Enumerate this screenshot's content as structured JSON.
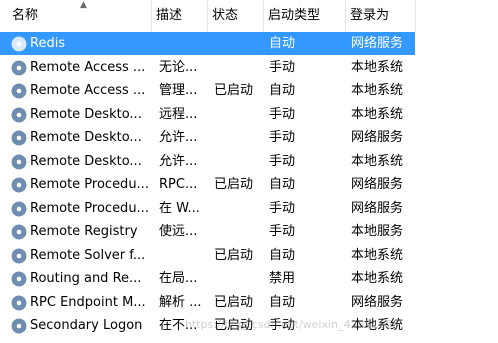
{
  "columns": {
    "name": "名称",
    "description": "描述",
    "status": "状态",
    "startup_type": "启动类型",
    "logon_as": "登录为"
  },
  "sort_indicator": "ascending",
  "rows": [
    {
      "name": "Redis",
      "description": "",
      "status": "",
      "startup_type": "自动",
      "logon_as": "网络服务",
      "selected": true
    },
    {
      "name": "Remote Access ...",
      "description": "无论...",
      "status": "",
      "startup_type": "手动",
      "logon_as": "本地系统"
    },
    {
      "name": "Remote Access ...",
      "description": "管理...",
      "status": "已启动",
      "startup_type": "自动",
      "logon_as": "本地系统"
    },
    {
      "name": "Remote Deskto...",
      "description": "远程...",
      "status": "",
      "startup_type": "手动",
      "logon_as": "本地系统"
    },
    {
      "name": "Remote Deskto...",
      "description": "允许...",
      "status": "",
      "startup_type": "手动",
      "logon_as": "网络服务"
    },
    {
      "name": "Remote Deskto...",
      "description": "允许...",
      "status": "",
      "startup_type": "手动",
      "logon_as": "本地系统"
    },
    {
      "name": "Remote Procedu...",
      "description": "RPC...",
      "status": "已启动",
      "startup_type": "自动",
      "logon_as": "网络服务"
    },
    {
      "name": "Remote Procedu...",
      "description": "在 W...",
      "status": "",
      "startup_type": "手动",
      "logon_as": "网络服务"
    },
    {
      "name": "Remote Registry",
      "description": "使远...",
      "status": "",
      "startup_type": "手动",
      "logon_as": "本地服务"
    },
    {
      "name": "Remote Solver f...",
      "description": "",
      "status": "已启动",
      "startup_type": "自动",
      "logon_as": "本地系统"
    },
    {
      "name": "Routing and Re...",
      "description": "在局...",
      "status": "",
      "startup_type": "禁用",
      "logon_as": "本地系统"
    },
    {
      "name": "RPC Endpoint M...",
      "description": "解析 ...",
      "status": "已启动",
      "startup_type": "自动",
      "logon_as": "网络服务"
    },
    {
      "name": "Secondary Logon",
      "description": "在不...",
      "status": "已启动",
      "startup_type": "手动",
      "logon_as": "本地系统"
    }
  ],
  "watermark": "https://blog.csdn.net/weixin_43851056",
  "colors": {
    "selected_bg": "#3399ff",
    "selected_text": "#ffffff",
    "gear": "#6f8db0"
  },
  "icons": {
    "service": "gear-icon"
  }
}
